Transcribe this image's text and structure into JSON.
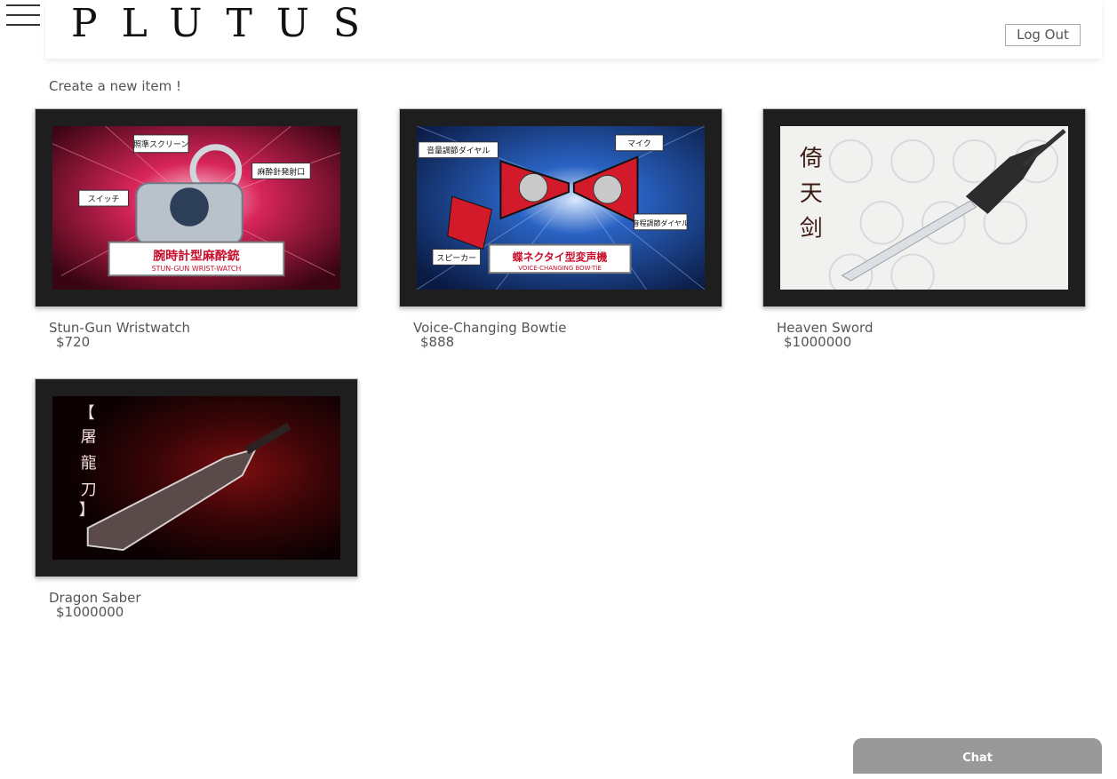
{
  "header": {
    "logo_text": "PLUTUS",
    "logout_label": "Log Out"
  },
  "create_link": "Create a new item !",
  "items": [
    {
      "name": "Stun-Gun Wristwatch",
      "price": "$720",
      "image": {
        "callout_top": "照準スクリーン",
        "callout_right": "麻酔針発射口",
        "callout_left": "スイッチ",
        "banner_jp": "腕時計型麻酔銃",
        "banner_en": "STUN-GUN WRIST-WATCH"
      }
    },
    {
      "name": "Voice-Changing Bowtie",
      "price": "$888",
      "image": {
        "callout_top_left": "音量調節ダイヤル",
        "callout_top_right": "マイク",
        "callout_right": "音程調節ダイヤル",
        "callout_left": "スピーカー",
        "banner_jp": "蝶ネクタイ型変声機",
        "banner_en": "VOICE-CHANGING BOW-TIE"
      }
    },
    {
      "name": "Heaven Sword",
      "price": "$1000000",
      "image": {
        "calligraphy": [
          "倚",
          "天",
          "剑"
        ]
      }
    },
    {
      "name": "Dragon Saber",
      "price": "$1000000",
      "image": {
        "calligraphy": [
          "屠",
          "龍",
          "刀"
        ]
      }
    }
  ],
  "chat": {
    "label": "Chat"
  }
}
